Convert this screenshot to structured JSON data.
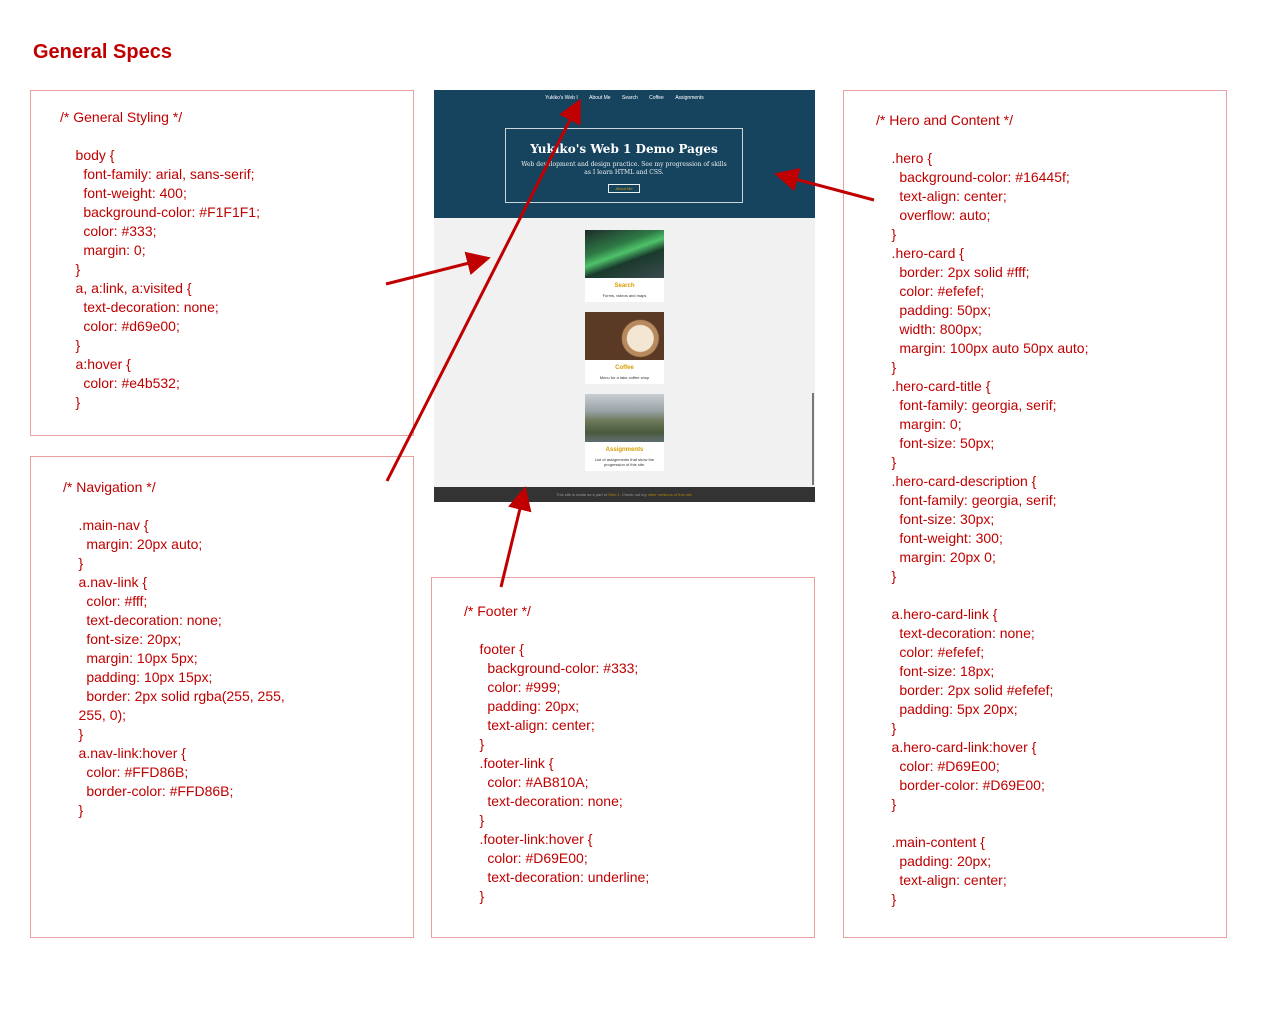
{
  "title": "General Specs",
  "general_box": {
    "lines": [
      "/* General Styling */",
      "",
      "    body {",
      "      font-family: arial, sans-serif;",
      "      font-weight: 400;",
      "      background-color: #F1F1F1;",
      "      color: #333;",
      "      margin: 0;",
      "    }",
      "    a, a:link, a:visited {",
      "      text-decoration: none;",
      "      color: #d69e00;",
      "    }",
      "    a:hover {",
      "      color: #e4b532;",
      "    }"
    ]
  },
  "navigation_box": {
    "lines": [
      "/* Navigation */",
      "",
      "    .main-nav {",
      "      margin: 20px auto;",
      "    }",
      "    a.nav-link {",
      "      color: #fff;",
      "      text-decoration: none;",
      "      font-size: 20px;",
      "      margin: 10px 5px;",
      "      padding: 10px 15px;",
      "      border: 2px solid rgba(255, 255,",
      "    255, 0);",
      "    }",
      "    a.nav-link:hover {",
      "      color: #FFD86B;",
      "      border-color: #FFD86B;",
      "    }"
    ]
  },
  "footer_box": {
    "lines": [
      "/* Footer */",
      "",
      "    footer {",
      "      background-color: #333;",
      "      color: #999;",
      "      padding: 20px;",
      "      text-align: center;",
      "    }",
      "    .footer-link {",
      "      color: #AB810A;",
      "      text-decoration: none;",
      "    }",
      "    .footer-link:hover {",
      "      color: #D69E00;",
      "      text-decoration: underline;",
      "    }"
    ]
  },
  "hero_box": {
    "lines": [
      "/* Hero and Content */",
      "",
      "    .hero {",
      "      background-color: #16445f;",
      "      text-align: center;",
      "      overflow: auto;",
      "    }",
      "    .hero-card {",
      "      border: 2px solid #fff;",
      "      color: #efefef;",
      "      padding: 50px;",
      "      width: 800px;",
      "      margin: 100px auto 50px auto;",
      "    }",
      "    .hero-card-title {",
      "      font-family: georgia, serif;",
      "      margin: 0;",
      "      font-size: 50px;",
      "    }",
      "    .hero-card-description {",
      "      font-family: georgia, serif;",
      "      font-size: 30px;",
      "      font-weight: 300;",
      "      margin: 20px 0;",
      "    }",
      "",
      "    a.hero-card-link {",
      "      text-decoration: none;",
      "      color: #efefef;",
      "      font-size: 18px;",
      "      border: 2px solid #efefef;",
      "      padding: 5px 20px;",
      "    }",
      "    a.hero-card-link:hover {",
      "      color: #D69E00;",
      "      border-color: #D69E00;",
      "    }",
      "",
      "    .main-content {",
      "      padding: 20px;",
      "      text-align: center;",
      "    }"
    ]
  },
  "mockup": {
    "nav": [
      "Yukiko's Web I",
      "About Me",
      "Search",
      "Coffee",
      "Assignments"
    ],
    "hero_title": "Yukiko's Web 1 Demo Pages",
    "hero_description": "Web development and design practice. See my progression of skills as I learn HTML and CSS.",
    "hero_link": "About Me",
    "tiles": [
      {
        "title": "Search",
        "description": "Forms, videos and maps",
        "image": "aurora-image"
      },
      {
        "title": "Coffee",
        "description": "Menu for a fake coffee shop",
        "image": "coffee-image"
      },
      {
        "title": "Assignments",
        "description": "List of assignments that show the progression of this site.",
        "image": "landscape-image"
      }
    ],
    "footer_text": "This site is made as a part of",
    "footer_link1": "Web 1",
    "footer_middle": ". Check out my",
    "footer_link2": "other versions of this site."
  },
  "colors": {
    "annotation": "#c00000",
    "box_border": "#e6a0a0",
    "hero_bg": "#16445f",
    "page_bg": "#f1f1f1",
    "footer_bg": "#333333",
    "link": "#d69e00"
  }
}
